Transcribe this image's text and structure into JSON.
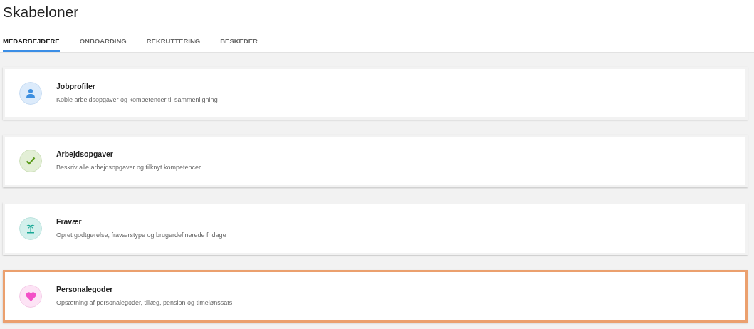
{
  "title": "Skabeloner",
  "tabs": [
    {
      "label": "MEDARBEJDERE",
      "selected": true
    },
    {
      "label": "ONBOARDING",
      "selected": false
    },
    {
      "label": "REKRUTTERING",
      "selected": false
    },
    {
      "label": "BESKEDER",
      "selected": false
    }
  ],
  "templates": [
    {
      "kind": "person",
      "title": "Jobprofiler",
      "description": "Koble arbejdsopgaver og kompetencer til sammenligning",
      "highlighted": false
    },
    {
      "kind": "check",
      "title": "Arbejdsopgaver",
      "description": "Beskriv alle arbejdsopgaver og tilknyt kompetencer",
      "highlighted": false
    },
    {
      "kind": "palm",
      "title": "Fravær",
      "description": "Opret godtgørelse, fraværstype og brugerdefinerede fridage",
      "highlighted": false
    },
    {
      "kind": "heart",
      "title": "Personalegoder",
      "description": "Opsætning af personalegoder, tillæg, pension og timelønssats",
      "highlighted": true
    }
  ]
}
